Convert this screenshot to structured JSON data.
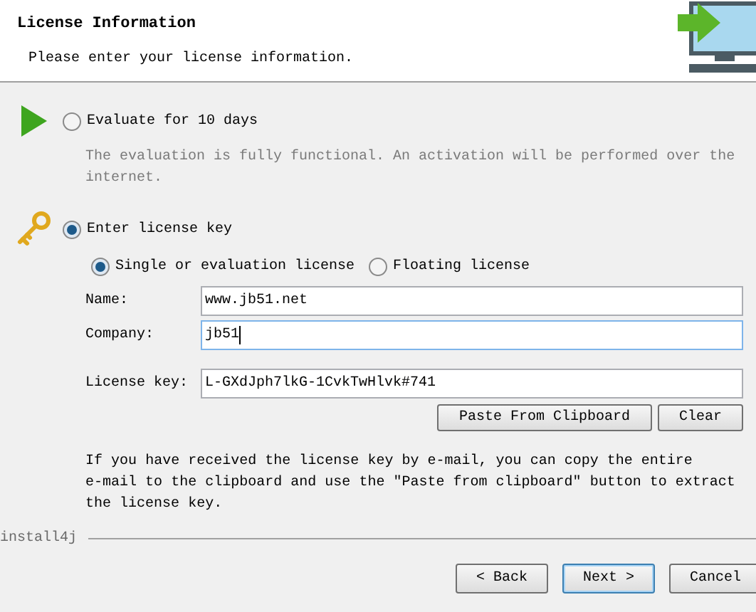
{
  "header": {
    "title": "License Information",
    "subtitle": "Please enter your license information."
  },
  "options": [
    {
      "kind": "evaluate",
      "label": "Evaluate for 10 days",
      "selected": false,
      "description": "The evaluation is fully functional. An activation will be performed over the internet."
    },
    {
      "kind": "key",
      "label": "Enter license key",
      "selected": true
    }
  ],
  "license_types": [
    {
      "label": "Single or evaluation license",
      "selected": true
    },
    {
      "label": "Floating license",
      "selected": false
    }
  ],
  "fields": [
    {
      "label": "Name:",
      "value": "www.jb51.net",
      "focused": false
    },
    {
      "label": "Company:",
      "value": "jb51",
      "focused": true
    },
    {
      "label": "License key:",
      "value": "L-GXdJph7lkG-1CvkTwHlvk#741",
      "focused": false
    }
  ],
  "key_buttons": [
    "Paste From Clipboard",
    "Clear"
  ],
  "info": "If you have received the license key by e-mail, you can copy the entire e-mail to the clipboard and use the \"Paste from clipboard\" button to extract the license key.",
  "brand": "install4j",
  "nav_buttons": [
    {
      "label": "< Back",
      "default": false
    },
    {
      "label": "Next >",
      "default": true
    },
    {
      "label": "Cancel",
      "default": false
    }
  ]
}
